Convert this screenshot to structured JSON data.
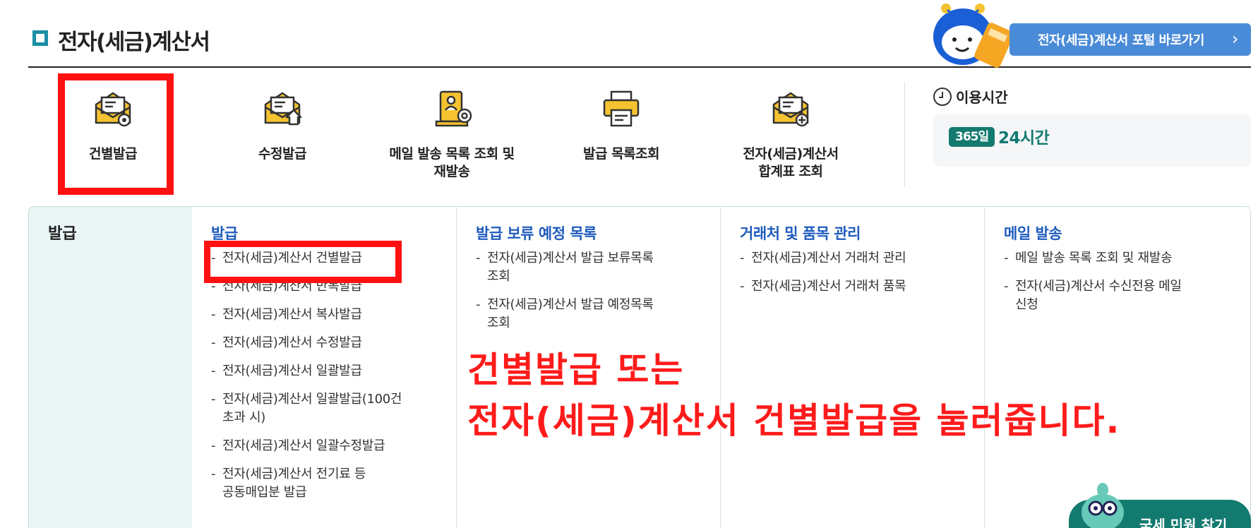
{
  "header": {
    "title": "전자(세금)계산서",
    "portal_button": "전자(세금)계산서 포털 바로가기"
  },
  "quick_menu": [
    {
      "label": "건별발급",
      "icon": "envelope-gear-icon"
    },
    {
      "label": "수정발급",
      "icon": "envelope-upload-icon"
    },
    {
      "label": "메일 발송 목록 조회 및\n재발송",
      "icon": "document-at-icon"
    },
    {
      "label": "발급 목록조회",
      "icon": "printer-icon"
    },
    {
      "label": "전자(세금)계산서\n합계표 조회",
      "icon": "envelope-plus-icon"
    }
  ],
  "usage": {
    "title": "이용시간",
    "badge": "365일",
    "hours": "24시간"
  },
  "panel": {
    "side_title": "발급",
    "columns": [
      {
        "heading": "발급",
        "items": [
          "전자(세금)계산서 건별발급",
          "전자(세금)계산서 반복발급",
          "전자(세금)계산서 복사발급",
          "전자(세금)계산서 수정발급",
          "전자(세금)계산서 일괄발급",
          "전자(세금)계산서 일괄발급(100건\n초과 시)",
          "전자(세금)계산서 일괄수정발급",
          "전자(세금)계산서 전기료 등\n공동매입분 발급"
        ]
      },
      {
        "heading": "발급 보류 예정 목록",
        "items": [
          "전자(세금)계산서 발급 보류목록\n조회",
          "전자(세금)계산서 발급 예정목록\n조회"
        ]
      },
      {
        "heading": "거래처 및 품목 관리",
        "items": [
          "전자(세금)계산서 거래처 관리",
          "전자(세금)계산서 거래처 품목"
        ]
      },
      {
        "heading": "메일 발송",
        "items": [
          "메일 발송 목록 조회 및 재발송",
          "전자(세금)계산서 수신전용 메일\n신청"
        ]
      }
    ]
  },
  "annotation": {
    "line1": "건별발급 또는",
    "line2": "전자(세금)계산서 건별발급을 눌러줍니다."
  },
  "faq_button": "국세 민원 찾기",
  "colors": {
    "accent_blue": "#4a8bd8",
    "teal": "#137a6f",
    "highlight_red": "#ff1111",
    "icon_yellow": "#f5c231"
  }
}
